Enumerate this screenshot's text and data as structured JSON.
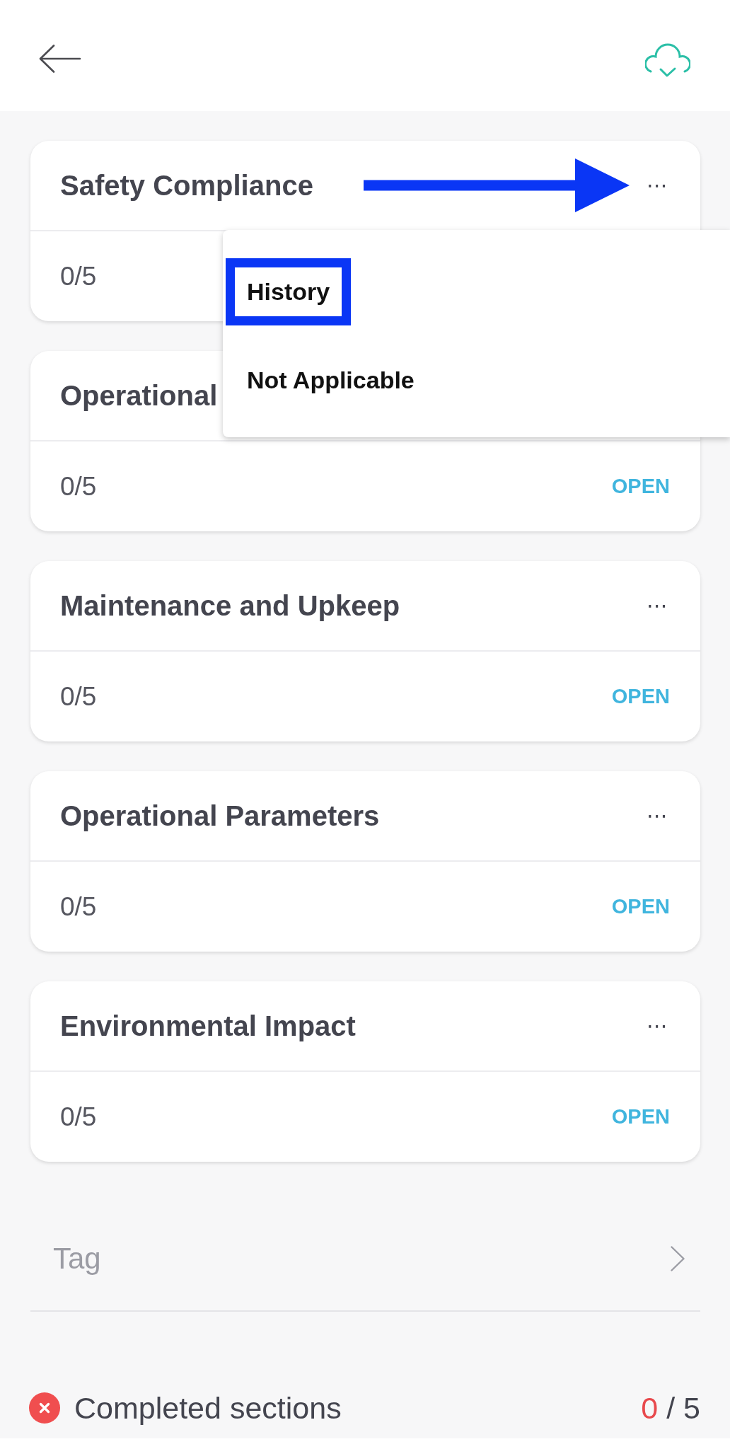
{
  "topbar": {
    "synced": true
  },
  "sections": [
    {
      "title": "Safety Compliance",
      "arrow": true,
      "more": "⋯",
      "progress": "0/5"
    },
    {
      "title": "Operational",
      "arrow": false,
      "progress": "0/5",
      "action": "OPEN"
    },
    {
      "title": "Maintenance and Upkeep",
      "arrow": false,
      "more": "⋯",
      "progress": "0/5",
      "action": "OPEN"
    },
    {
      "title": "Operational Parameters",
      "arrow": false,
      "more": "⋯",
      "progress": "0/5",
      "action": "OPEN"
    },
    {
      "title": "Environmental Impact",
      "arrow": false,
      "more": "⋯",
      "progress": "0/5",
      "action": "OPEN"
    }
  ],
  "menu": {
    "open": true,
    "items": [
      {
        "label": "History",
        "highlighted": true
      },
      {
        "label": "Not Applicable",
        "highlighted": false
      }
    ]
  },
  "tag": {
    "label": "Tag"
  },
  "completed": {
    "label": "Completed sections",
    "done": false,
    "count": "0",
    "total": "/ 5"
  }
}
